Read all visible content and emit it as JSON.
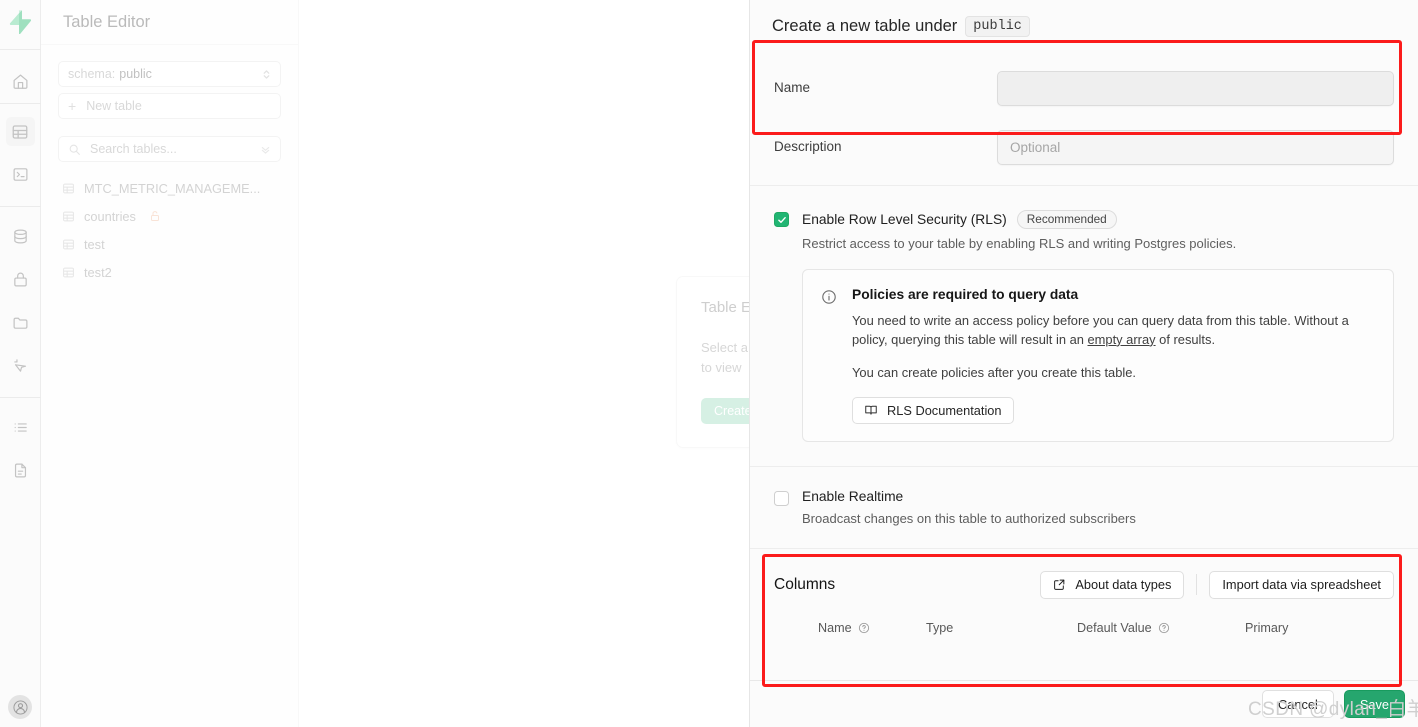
{
  "rail": {
    "logo": "supabase-logo",
    "items": [
      {
        "name": "home-icon",
        "label": "Home"
      },
      {
        "name": "table-editor-icon",
        "label": "Table Editor"
      },
      {
        "name": "sql-editor-icon",
        "label": "SQL Editor"
      },
      {
        "name": "database-icon",
        "label": "Database"
      },
      {
        "name": "authentication-icon",
        "label": "Authentication"
      },
      {
        "name": "storage-icon",
        "label": "Storage"
      },
      {
        "name": "edge-functions-icon",
        "label": "Edge Functions"
      },
      {
        "name": "logs-icon",
        "label": "Logs"
      },
      {
        "name": "reports-icon",
        "label": "Reports"
      }
    ],
    "avatar": "user-avatar"
  },
  "nav": {
    "title": "Table Editor",
    "schema_prefix": "schema:",
    "schema_value": "public",
    "new_table_label": "New table",
    "search_placeholder": "Search tables...",
    "tables": [
      {
        "name": "MTC_METRIC_MANAGEME...",
        "locked": false
      },
      {
        "name": "countries",
        "locked": true
      },
      {
        "name": "test",
        "locked": false
      },
      {
        "name": "test2",
        "locked": false
      }
    ]
  },
  "background_card": {
    "title": "Table E",
    "line1": "Select a",
    "line2": "to view",
    "button": "Create"
  },
  "panel": {
    "heading": "Create a new table under",
    "schema_chip": "public",
    "name": {
      "label": "Name",
      "value": "",
      "placeholder": ""
    },
    "description": {
      "label": "Description",
      "value": "",
      "placeholder": "Optional"
    },
    "rls": {
      "checked": true,
      "title": "Enable Row Level Security (RLS)",
      "badge": "Recommended",
      "subtitle": "Restrict access to your table by enabling RLS and writing Postgres policies.",
      "notice": {
        "icon": "info-icon",
        "title": "Policies are required to query data",
        "paragraph1_before": "You need to write an access policy before you can query data from this table. Without a policy, querying this table will result in an ",
        "paragraph1_link": "empty array",
        "paragraph1_after": " of results.",
        "paragraph2": "You can create policies after you create this table.",
        "doc_button": "RLS Documentation"
      }
    },
    "realtime": {
      "checked": false,
      "title": "Enable Realtime",
      "subtitle": "Broadcast changes on this table to authorized subscribers"
    },
    "columns": {
      "title": "Columns",
      "about_button": "About data types",
      "import_button": "Import data via spreadsheet",
      "headers": [
        {
          "label": "Name",
          "help": true
        },
        {
          "label": "Type",
          "help": false
        },
        {
          "label": "Default Value",
          "help": true
        },
        {
          "label": "Primary",
          "help": false
        }
      ]
    },
    "footer": {
      "cancel": "Cancel",
      "save": "Save"
    }
  },
  "annotations": {
    "color": "#fb1b1b",
    "boxes": [
      "name-field-highlight",
      "columns-section-highlight"
    ]
  },
  "watermark": {
    "text": "CSDN @dylan_白羊"
  }
}
